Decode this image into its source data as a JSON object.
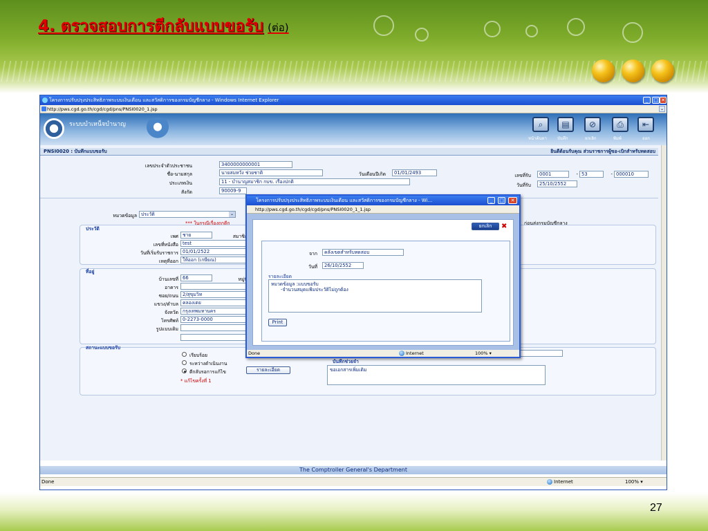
{
  "slide": {
    "title": "4. ตรวจสอบการตีกลับแบบขอรับ",
    "title_suffix": "(ต่อ)",
    "page_number": "27",
    "accent_color": "#e00000"
  },
  "main_window": {
    "title": "โครงการปรับปรุงประสิทธิภาพระบบเงินเดือน และสวัสดิการของกรมบัญชีกลาง - Windows Internet Explorer",
    "url": "http://pws.cgd.go.th/cgd/cgd/pns/PNSI0020_1.jsp",
    "banner_title": "ระบบบำเหน็จบำนาญ",
    "toolbar": [
      {
        "label": "หน้าค้นหา",
        "icon": "search-icon"
      },
      {
        "label": "บันทึก",
        "icon": "save-icon"
      },
      {
        "label": "ยกเลิก",
        "icon": "cancel-icon"
      },
      {
        "label": "พิมพ์",
        "icon": "print-icon"
      },
      {
        "label": "ออก",
        "icon": "exit-icon"
      }
    ],
    "page_code": "PNSI0020 : บันทึกแบบขอรับ",
    "welcome": "ยินดีต้อนรับคุณ ส่วนราชการผู้ขอ-เบิกสำหรับทดสอบ",
    "form": {
      "id_label": "เลขประจำตัวประชาชน",
      "id_value": "3400000000001",
      "name_label": "ชื่อ-นามสกุล",
      "name_value": "นายสมหวัง ช่วยชาติ",
      "birth_label": "วันเดือนปีเกิด",
      "birth_value": "01/01/2493",
      "type_label": "ประเภทเงิน",
      "type_value": "11 - บำนาญสมาชิก กบข. เรื่องปกติ",
      "affil_label": "สังกัด",
      "affil_value": "90009-9",
      "recv_no_label": "เลขที่รับ",
      "recv_no_1": "0001",
      "recv_no_2": "53",
      "recv_no_3": "000010",
      "recv_sep": "-",
      "recv_date_label": "วันที่รับ",
      "recv_date_value": "25/10/2552",
      "group_label": "หมวดข้อมูล",
      "group_value": "ประวัติ",
      "red_note_prefix": "*** ในกรณี",
      "red_note_link": "เรื่องถูกตีก",
      "right_note": "ก่อนส่งกรมบัญชีกลาง"
    },
    "history": {
      "section": "ประวัติ",
      "gender_label": "เพศ",
      "gender_value": "ชาย",
      "status_label": "สมาชิก",
      "book_label": "เลขที่หนังสือ",
      "book_value": "test",
      "start_label": "วันที่เริ่มรับราชการ",
      "start_value": "01/01/2522",
      "reason_label": "เหตุที่ออก",
      "reason_value": "ให้ออก (เกษียณ)"
    },
    "address": {
      "section": "ที่อยู่",
      "house_label": "บ้านเลขที่",
      "house_value": "66",
      "moo_label": "หมู่ที่",
      "building_label": "อาคาร",
      "soi_label": "ซอย/ถนน",
      "soi_value": "2/สุขุมวิท",
      "district_label": "แขวง/ตำบล",
      "district_value": "คลองเตย",
      "province_label": "จังหวัด",
      "province_value": "กรุงเทพมหานคร",
      "phone_label": "โทรศัพท์",
      "phone_value": "0-2273-0000",
      "old_label": "รูปแบบเดิม"
    },
    "request_status": {
      "section": "สถานะแบบขอรับ",
      "options": [
        "เรียบร้อย",
        "ระหว่างดำเนินงาน",
        "ตีกลับรอการแก้ไข"
      ],
      "selected": 2,
      "detail_button": "รายละเอียด",
      "fix_note": "* แก้ไขครั้งที่ 1",
      "note_label": "บันทึกช่วยจำ",
      "note_value": "ขอเอกสารเพิ่มเติม"
    },
    "footer": "The Comptroller General's Department",
    "statusbar": {
      "left": "Done",
      "zone": "Internet",
      "zoom": "100%"
    }
  },
  "popup_window": {
    "title": "โครงการปรับปรุงประสิทธิภาพระบบเงินเดือน และสวัสดิการของกรมบัญชีกลาง - Wi...",
    "url": "http://pws.cgd.go.th/cgd/cgd/pns/PNSI0020_1_1.jsp",
    "cancel_button": "ยกเลิก",
    "from_label": "จาก",
    "from_value": "คลังเขตสำหรับทดสอบ",
    "date_label": "วันที่",
    "date_value": "26/10/2552",
    "detail_section": "รายละเอียด",
    "detail_line1": "หมวดข้อมูล :แบบขอรับ",
    "detail_line2": "-จำนวนสมุดแฟ้มประวัติไม่ถูกต้อง",
    "print_button": "Print",
    "statusbar": {
      "left": "Done",
      "zone": "Internet",
      "zoom": "100%"
    }
  }
}
